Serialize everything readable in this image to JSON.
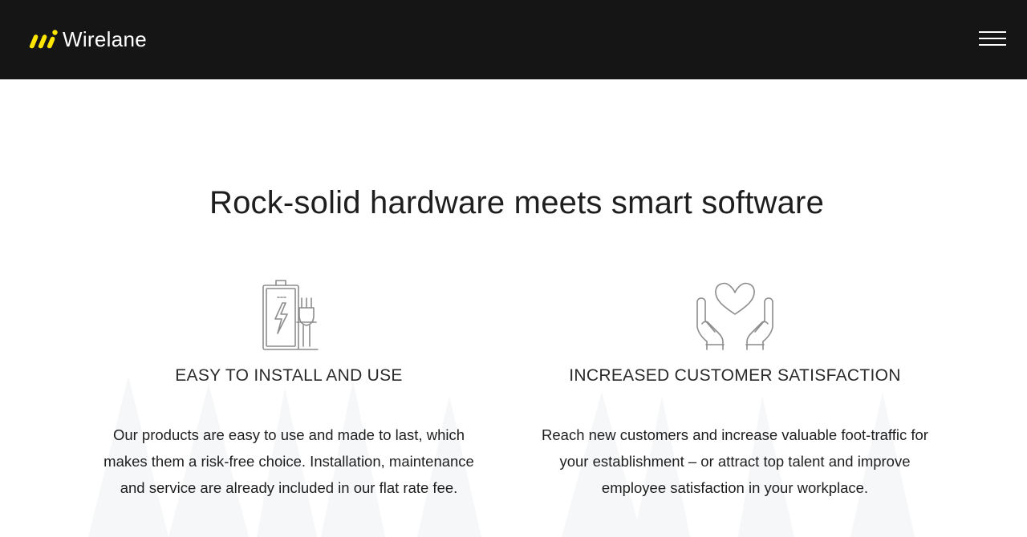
{
  "header": {
    "brand_name": "Wirelane",
    "logo_icon": "wirelane-logo-icon",
    "menu_icon": "hamburger-menu-icon"
  },
  "main": {
    "title": "Rock-solid hardware meets smart software",
    "features": [
      {
        "icon": "battery-plug-icon",
        "title": "EASY TO INSTALL AND USE",
        "text": "Our products are easy to use and made to last, which makes them a risk-free choice. Installation, maintenance and service are already included in our flat rate fee."
      },
      {
        "icon": "hands-heart-icon",
        "title": "INCREASED CUSTOMER SATISFACTION",
        "text": "Reach new customers and increase valuable foot-traffic for your establishment – or attract top talent and improve employee satisfaction in your workplace."
      }
    ]
  },
  "colors": {
    "header_bg": "#151515",
    "brand_accent": "#ffe600",
    "text": "#1e1e1e",
    "icon_stroke": "#8c8c8c"
  }
}
